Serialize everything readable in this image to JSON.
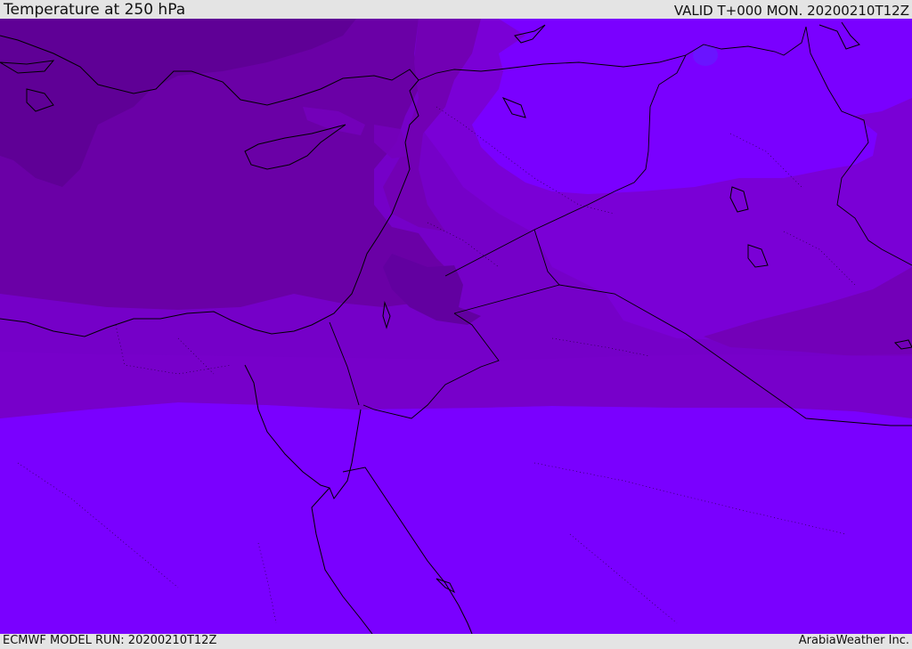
{
  "header": {
    "title": "Temperature at 250 hPa",
    "valid": "VALID T+000 MON. 20200210T12Z"
  },
  "footer": {
    "model_run": "ECMWF MODEL RUN: 20200210T12Z",
    "credit": "ArabiaWeather Inc."
  },
  "map": {
    "variable": "Temperature at 250 hPa",
    "colors": {
      "darkest": "#5f0096",
      "dark": "#6a00a5",
      "mid": "#7400bb",
      "mid_light": "#7a00cc",
      "light": "#7a00ff",
      "blue_patch": "#6a14ff",
      "coastline": "#000000"
    }
  }
}
